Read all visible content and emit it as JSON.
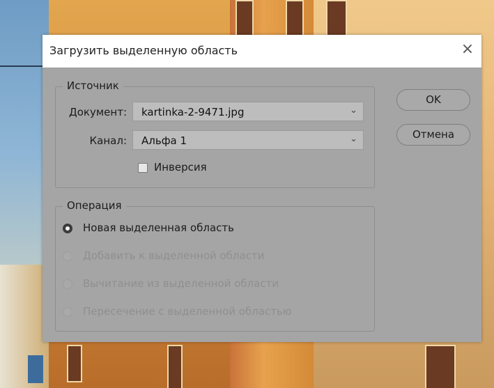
{
  "dialog": {
    "title": "Загрузить выделенную область",
    "close_icon": "×"
  },
  "source": {
    "legend": "Источник",
    "document_label": "Документ:",
    "document_value": "kartinka-2-9471.jpg",
    "channel_label": "Канал:",
    "channel_value": "Альфа 1",
    "invert_label": "Инверсия",
    "invert_checked": false
  },
  "operation": {
    "legend": "Операция",
    "options": [
      {
        "label": "Новая выделенная область",
        "selected": true,
        "enabled": true
      },
      {
        "label": "Добавить к выделенной области",
        "selected": false,
        "enabled": false
      },
      {
        "label": "Вычитание из выделенной области",
        "selected": false,
        "enabled": false
      },
      {
        "label": "Пересечение с выделенной областью",
        "selected": false,
        "enabled": false
      }
    ]
  },
  "buttons": {
    "ok": "OK",
    "cancel": "Отмена"
  },
  "icons": {
    "dropdown": "chevron-down-icon",
    "close": "close-icon"
  },
  "colors": {
    "dialog_bg": "#a5a5a5",
    "titlebar_bg": "#ffffff",
    "disabled_text": "#8f8f8f"
  }
}
